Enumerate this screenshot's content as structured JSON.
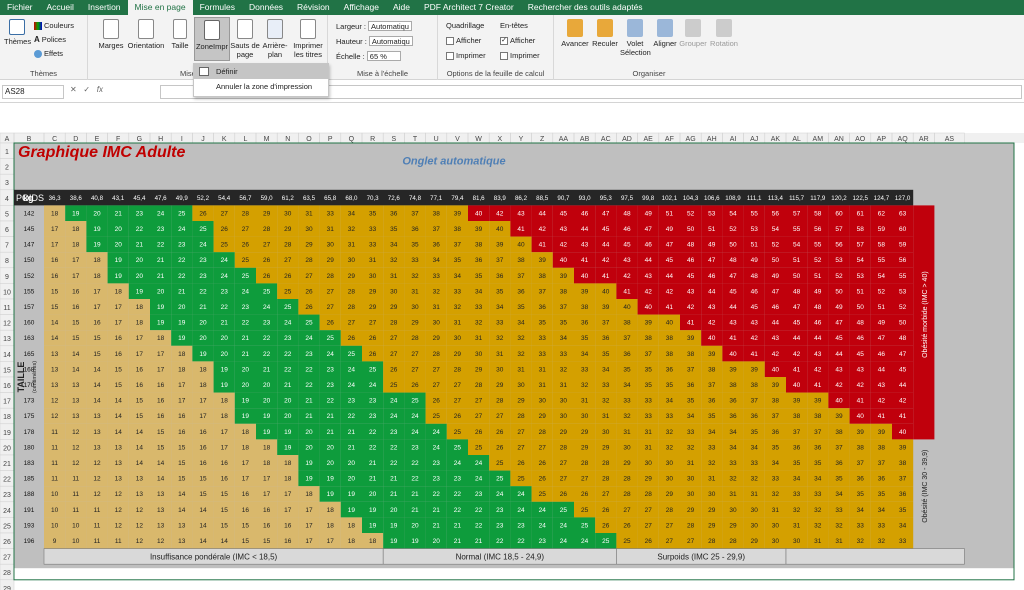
{
  "tabs": [
    "Fichier",
    "Accueil",
    "Insertion",
    "Mise en page",
    "Formules",
    "Données",
    "Révision",
    "Affichage",
    "Aide",
    "PDF Architect 7 Creator",
    "Rechercher des outils adaptés"
  ],
  "active_tab": "Mise en page",
  "ribbon": {
    "themes": {
      "label": "Thèmes",
      "btn": "Thèmes",
      "colors": "Couleurs",
      "fonts": "Polices",
      "effects": "Effets"
    },
    "page_setup": {
      "label": "Mise",
      "margins": "Marges",
      "orientation": "Orientation",
      "size": "Taille",
      "print_area": "ZoneImpr",
      "breaks_1": "Sauts de",
      "breaks_2": "page",
      "background_1": "Arrière-",
      "background_2": "plan",
      "titles_1": "Imprimer",
      "titles_2": "les titres"
    },
    "scale": {
      "label": "Mise à l'échelle",
      "width": "Largeur :",
      "width_val": "Automatiqu",
      "height": "Hauteur :",
      "height_val": "Automatiqu",
      "scale": "Échelle :",
      "scale_val": "65 %"
    },
    "sheet_opts": {
      "label": "Options de la feuille de calcul",
      "gridlines": "Quadrillage",
      "headings": "En-têtes",
      "view": "Afficher",
      "print": "Imprimer",
      "view2": "Afficher",
      "print2": "Imprimer"
    },
    "arrange": {
      "label": "Organiser",
      "forward": "Avancer",
      "backward": "Reculer",
      "pane_1": "Volet",
      "pane_2": "Sélection",
      "align": "Aligner",
      "group": "Grouper",
      "rotate": "Rotation"
    }
  },
  "dropdown": {
    "define": "Définir",
    "clear": "Annuler la zone d'impression"
  },
  "formula": {
    "namebox": "AS28",
    "fx": "fx"
  },
  "sheet": {
    "col_headers": [
      "A",
      "B",
      "C",
      "D",
      "E",
      "F",
      "G",
      "H",
      "I",
      "J",
      "K",
      "L",
      "M",
      "N",
      "O",
      "P",
      "Q",
      "R",
      "S",
      "T",
      "U",
      "V",
      "W",
      "X",
      "Y",
      "Z",
      "AA",
      "AB",
      "AC",
      "AD",
      "AE",
      "AF",
      "AG",
      "AH",
      "AI",
      "AJ",
      "AK",
      "AL",
      "AM",
      "AN",
      "AO",
      "AP",
      "AQ",
      "AR",
      "AS"
    ],
    "row_headers": [
      "1",
      "2",
      "3",
      "4",
      "5",
      "6",
      "7",
      "8",
      "9",
      "10",
      "11",
      "12",
      "13",
      "14",
      "15",
      "16",
      "17",
      "18",
      "19",
      "20",
      "21",
      "22",
      "23",
      "24",
      "25",
      "26",
      "27",
      "28",
      "29"
    ],
    "title": "Graphique IMC Adulte",
    "subtitle": "Onglet automatique",
    "poids_label": "POIDS",
    "kg_label": "kg",
    "taille_label": "TAILLE",
    "taille_unit": "(centimètres)",
    "obese_label": "Obésité morbide (IMC > 40)",
    "obese2_label": "Obésité (IMC 30 - 39,9)",
    "footer": [
      {
        "text": "Insuffisance pondérale (IMC < 18,5)",
        "from": 0,
        "to": 15
      },
      {
        "text": "Normal (IMC 18,5 - 24,9)",
        "from": 16,
        "to": 26
      },
      {
        "text": "Surpoids (IMC 25 - 29,9)",
        "from": 27,
        "to": 34
      },
      {
        "text": "",
        "from": 35,
        "to": 42
      }
    ],
    "weights": [
      "36,3",
      "38,6",
      "40,8",
      "43,1",
      "45,4",
      "47,6",
      "49,9",
      "52,2",
      "54,4",
      "56,7",
      "59,0",
      "61,2",
      "63,5",
      "65,8",
      "68,0",
      "70,3",
      "72,6",
      "74,8",
      "77,1",
      "79,4",
      "81,6",
      "83,9",
      "86,2",
      "88,5",
      "90,7",
      "93,0",
      "95,3",
      "97,5",
      "99,8",
      "102,1",
      "104,3",
      "106,6",
      "108,9",
      "111,1",
      "113,4",
      "115,7",
      "117,9",
      "120,2",
      "122,5",
      "124,7",
      "127,0"
    ],
    "heights": [
      "142",
      "145",
      "147",
      "150",
      "152",
      "155",
      "157",
      "160",
      "163",
      "165",
      "168",
      "170",
      "173",
      "175",
      "178",
      "180",
      "183",
      "185",
      "188",
      "191",
      "193",
      "196"
    ],
    "colors": {
      "under": "#d9b86c",
      "normal": "#0e9c3c",
      "over": "#d4a000",
      "obese": "#d4a000",
      "morbid": "#c0000c",
      "header": "#262626",
      "gray": "#bfbfbf"
    }
  }
}
